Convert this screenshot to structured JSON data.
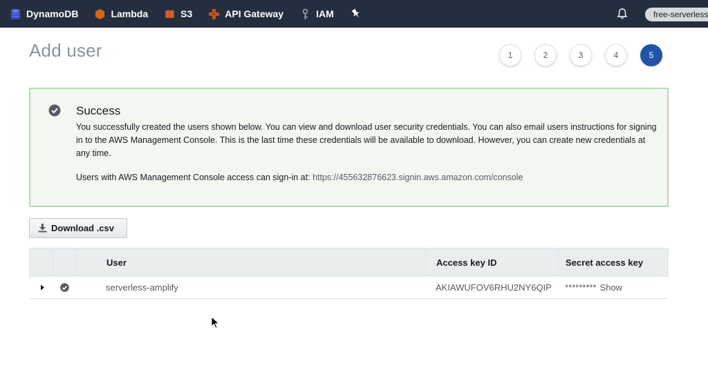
{
  "nav": {
    "items": [
      {
        "label": "DynamoDB",
        "icon": "dynamodb-icon"
      },
      {
        "label": "Lambda",
        "icon": "lambda-icon"
      },
      {
        "label": "S3",
        "icon": "s3-icon"
      },
      {
        "label": "API Gateway",
        "icon": "api-gateway-icon"
      },
      {
        "label": "IAM",
        "icon": "iam-icon"
      }
    ],
    "pin_icon": "pin-icon",
    "bell_icon": "bell-icon",
    "account_label": "free-serverless"
  },
  "page": {
    "title": "Add user",
    "steps": [
      "1",
      "2",
      "3",
      "4",
      "5"
    ],
    "active_step": "5"
  },
  "alert": {
    "title": "Success",
    "body": "You successfully created the users shown below. You can view and download user security credentials. You can also email users instructions for signing in to the AWS Management Console. This is the last time these credentials will be available to download. However, you can create new credentials at any time.",
    "signin_prefix": "Users with AWS Management Console access can sign-in at:",
    "signin_url": "https://455632876623.signin.aws.amazon.com/console"
  },
  "actions": {
    "download_label": "Download .csv"
  },
  "table": {
    "headers": {
      "user": "User",
      "access_key": "Access key ID",
      "secret_key": "Secret access key"
    },
    "rows": [
      {
        "user": "serverless-amplify",
        "access_key": "AKIAWUFOV6RHU2NY6QIP",
        "secret_masked": "*********",
        "show_label": "Show"
      }
    ]
  },
  "colors": {
    "nav_bg": "#232f3e",
    "active_step": "#1f55a6",
    "alert_bg": "#f2f8f0",
    "alert_border": "#b7dab0"
  }
}
